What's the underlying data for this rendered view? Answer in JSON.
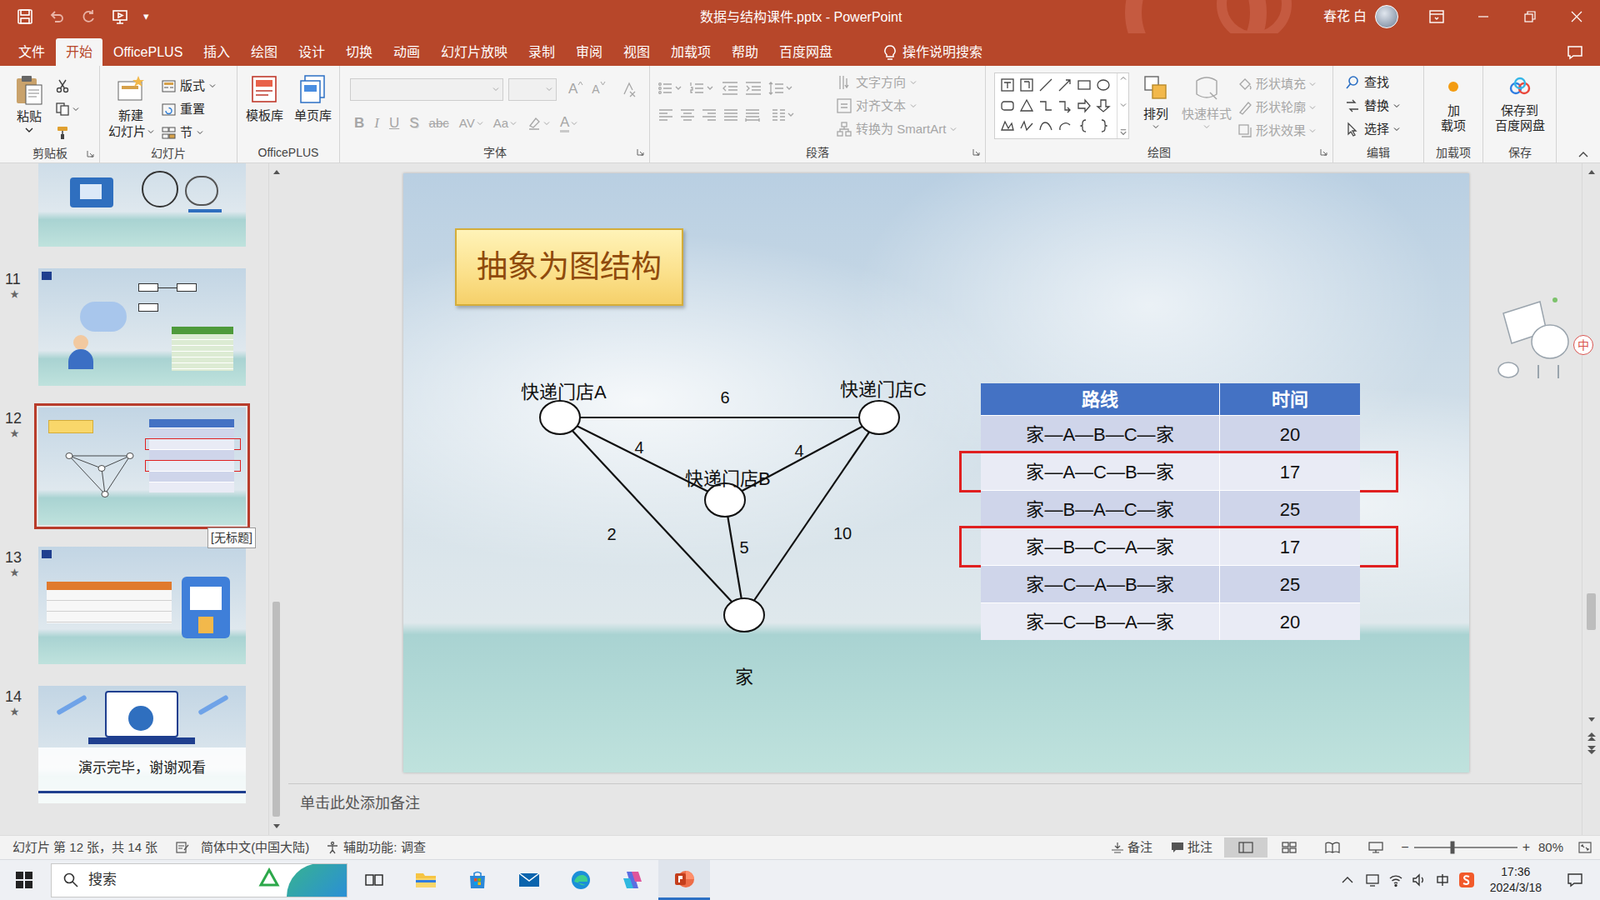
{
  "window": {
    "title": "数据与结构课件.pptx - PowerPoint",
    "user": "春花 白",
    "qat_more": "▾"
  },
  "menu": {
    "tabs": [
      {
        "label": "文件",
        "selected": false
      },
      {
        "label": "开始",
        "selected": true
      },
      {
        "label": "OfficePLUS",
        "selected": false
      },
      {
        "label": "插入",
        "selected": false
      },
      {
        "label": "绘图",
        "selected": false
      },
      {
        "label": "设计",
        "selected": false
      },
      {
        "label": "切换",
        "selected": false
      },
      {
        "label": "动画",
        "selected": false
      },
      {
        "label": "幻灯片放映",
        "selected": false
      },
      {
        "label": "录制",
        "selected": false
      },
      {
        "label": "审阅",
        "selected": false
      },
      {
        "label": "视图",
        "selected": false
      },
      {
        "label": "加载项",
        "selected": false
      },
      {
        "label": "帮助",
        "selected": false
      },
      {
        "label": "百度网盘",
        "selected": false
      }
    ],
    "tell_me": "操作说明搜索"
  },
  "ribbon": {
    "clipboard": {
      "label": "剪贴板",
      "paste": "粘贴"
    },
    "slides": {
      "label": "幻灯片",
      "new_slide_1": "新建",
      "new_slide_2": "幻灯片",
      "layout": "版式",
      "reset": "重置",
      "section": "节"
    },
    "officeplus": {
      "label": "OfficePLUS",
      "templates": "模板库",
      "single_pages": "单页库"
    },
    "font": {
      "label": "字体",
      "disabled": true,
      "grow": "A",
      "shrink": "A",
      "format_buttons": [
        {
          "label": "B",
          "kind": "bold"
        },
        {
          "label": "I",
          "kind": "italic"
        },
        {
          "label": "U",
          "kind": "underline"
        },
        {
          "label": "S",
          "kind": "shadow"
        },
        {
          "label": "abc",
          "kind": "strike"
        },
        {
          "label": "AV",
          "kind": "spacing"
        },
        {
          "label": "Aa",
          "kind": "case"
        },
        {
          "label": "A",
          "kind": "color"
        }
      ]
    },
    "paragraph": {
      "label": "段落",
      "disabled": true,
      "text_direction": "文字方向",
      "align_text": "对齐文本",
      "smartart": "转换为 SmartArt"
    },
    "drawing": {
      "label": "绘图",
      "arrange": "排列",
      "quick_styles": {
        "label": "快速样式",
        "disabled": true
      },
      "shape_buttons": [
        {
          "label": "形状填充",
          "kind": "fill",
          "disabled": true
        },
        {
          "label": "形状轮廓",
          "kind": "outline",
          "disabled": true
        },
        {
          "label": "形状效果",
          "kind": "effect",
          "disabled": true
        }
      ]
    },
    "editing": {
      "label": "编辑",
      "buttons": [
        {
          "label": "查找",
          "kind": "find"
        },
        {
          "label": "替换",
          "kind": "replace"
        },
        {
          "label": "选择",
          "kind": "select"
        }
      ]
    },
    "addins": {
      "label": "加载项",
      "line1": "加",
      "line2": "载项"
    },
    "save": {
      "label": "保存",
      "line1": "保存到",
      "line2": "百度网盘"
    }
  },
  "thumbnails": [
    {
      "number": "11",
      "star": "★",
      "selected": false,
      "kind": "chat"
    },
    {
      "number": "12",
      "star": "★",
      "selected": true,
      "kind": "graph"
    },
    {
      "number": "13",
      "star": "★",
      "selected": false,
      "kind": "table"
    },
    {
      "number": "14",
      "star": "★",
      "selected": false,
      "kind": "end",
      "caption": "演示完毕，谢谢观看"
    }
  ],
  "tooltip": "[无标题]",
  "slide": {
    "title": "抽象为图结构",
    "nodes": [
      {
        "label": "快递门店A"
      },
      {
        "label": "快递门店C"
      },
      {
        "label": "快递门店B"
      },
      {
        "label": "家"
      }
    ],
    "edges": [
      {
        "from": 0,
        "to": 1,
        "weight": "6"
      },
      {
        "from": 0,
        "to": 2,
        "weight": "4"
      },
      {
        "from": 1,
        "to": 2,
        "weight": "4"
      },
      {
        "from": 0,
        "to": 3,
        "weight": "2"
      },
      {
        "from": 2,
        "to": 3,
        "weight": "5"
      },
      {
        "from": 1,
        "to": 3,
        "weight": "10"
      }
    ],
    "table": {
      "columns": [
        "路线",
        "时间"
      ],
      "rows": [
        {
          "route": "家—A—B—C—家",
          "time": "20",
          "highlighted": false
        },
        {
          "route": "家—A—C—B—家",
          "time": "17",
          "highlighted": true
        },
        {
          "route": "家—B—A—C—家",
          "time": "25",
          "highlighted": false
        },
        {
          "route": "家—B—C—A—家",
          "time": "17",
          "highlighted": true
        },
        {
          "route": "家—C—A—B—家",
          "time": "25",
          "highlighted": false
        },
        {
          "route": "家—C—B—A—家",
          "time": "20",
          "highlighted": false
        }
      ]
    }
  },
  "notes": {
    "placeholder": "单击此处添加备注"
  },
  "ime_widget": "中",
  "status_bar": {
    "slide_info": "幻灯片 第 12 张，共 14 张",
    "language": "简体中文(中国大陆)",
    "accessibility": "辅助功能: 调查",
    "notes": "备注",
    "comments": "批注",
    "views": [
      {
        "kind": "normal",
        "selected": true
      },
      {
        "kind": "sorter",
        "selected": false
      },
      {
        "kind": "reading",
        "selected": false
      },
      {
        "kind": "slideshow",
        "selected": false
      }
    ],
    "zoom_minus": "−",
    "zoom_plus": "+",
    "zoom": "80%",
    "zoom_level": 0.37
  },
  "taskbar": {
    "search": "搜索",
    "time": "17:36",
    "date": "2024/3/18",
    "apps": [
      {
        "kind": "task-view",
        "selected": false
      },
      {
        "kind": "explorer",
        "selected": false
      },
      {
        "kind": "store",
        "selected": false
      },
      {
        "kind": "mail",
        "selected": false
      },
      {
        "kind": "edge",
        "selected": false
      },
      {
        "kind": "copilot",
        "selected": false
      },
      {
        "kind": "powerpoint",
        "selected": true
      }
    ]
  }
}
